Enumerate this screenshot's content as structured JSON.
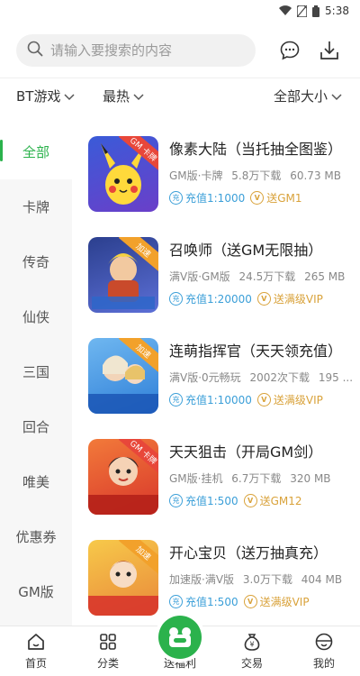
{
  "status": {
    "time": "5:38"
  },
  "search": {
    "placeholder": "请输入要搜索的内容"
  },
  "filters": {
    "category": "BT游戏",
    "sort": "最热",
    "size": "全部大小"
  },
  "sidebar": {
    "items": [
      {
        "label": "全部",
        "active": true
      },
      {
        "label": "卡牌"
      },
      {
        "label": "传奇"
      },
      {
        "label": "仙侠"
      },
      {
        "label": "三国"
      },
      {
        "label": "回合"
      },
      {
        "label": "唯美"
      },
      {
        "label": "优惠券"
      },
      {
        "label": "GM版"
      }
    ]
  },
  "games": [
    {
      "title": "像素大陆（当托抽全图鉴）",
      "meta": [
        "GM版·卡牌",
        "5.8万下载",
        "60.73 MB"
      ],
      "charge": "充值1:1000",
      "gift": "送GM1",
      "badge": "GM 卡牌",
      "thumb_art": "pikachu"
    },
    {
      "title": "召唤师（送GM无限抽）",
      "meta": [
        "满V版·GM版",
        "24.5万下载",
        "265 MB"
      ],
      "charge": "充值1:20000",
      "gift": "送满级VIP",
      "badge": "加速",
      "thumb_art": "summoner"
    },
    {
      "title": "连萌指挥官（天天领充值）",
      "meta": [
        "满V版·0元畅玩",
        "2002次下载",
        "195 ..."
      ],
      "charge": "充值1:10000",
      "gift": "送满级VIP",
      "badge": "加速",
      "thumb_art": "commander"
    },
    {
      "title": "天天狙击（开局GM剑）",
      "meta": [
        "GM版·挂机",
        "6.7万下载",
        "320 MB"
      ],
      "charge": "充值1:500",
      "gift": "送GM12",
      "badge": "GM 卡牌",
      "thumb_art": "sniper"
    },
    {
      "title": "开心宝贝（送万抽真充）",
      "meta": [
        "加速版·满V版",
        "3.0万下载",
        "404 MB"
      ],
      "charge": "充值1:500",
      "gift": "送满级VIP",
      "badge": "加速",
      "thumb_art": "baby"
    }
  ],
  "tabbar": {
    "items": [
      {
        "label": "首页",
        "icon": "home-icon"
      },
      {
        "label": "分类",
        "icon": "grid-icon"
      },
      {
        "label": "送福利",
        "icon": "gift-icon"
      },
      {
        "label": "交易",
        "icon": "money-bag-icon"
      },
      {
        "label": "我的",
        "icon": "user-icon"
      }
    ]
  },
  "colors": {
    "accent": "#2bb24c",
    "charge": "#3b9fd8",
    "gift": "#d9a23a"
  }
}
